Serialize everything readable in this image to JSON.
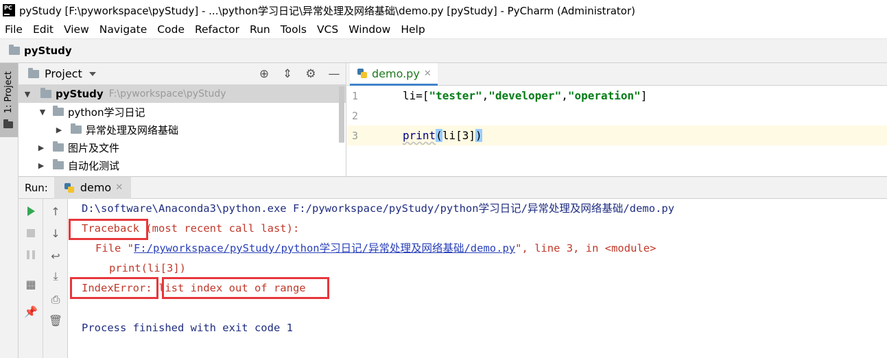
{
  "window": {
    "title": "pyStudy [F:\\pyworkspace\\pyStudy] - ...\\python学习日记\\异常处理及网络基础\\demo.py [pyStudy] - PyCharm (Administrator)"
  },
  "menu": [
    "File",
    "Edit",
    "View",
    "Navigate",
    "Code",
    "Refactor",
    "Run",
    "Tools",
    "VCS",
    "Window",
    "Help"
  ],
  "navbar": {
    "project": "pyStudy"
  },
  "left_strip": {
    "tab_label": "1: Project"
  },
  "project_panel": {
    "title": "Project",
    "tree": [
      {
        "label": "pyStudy",
        "path": "F:\\pyworkspace\\pyStudy",
        "expanded": true
      },
      {
        "label": "python学习日记",
        "expanded": true
      },
      {
        "label": "异常处理及网络基础",
        "expanded": false
      },
      {
        "label": "图片及文件",
        "expanded": false
      },
      {
        "label": "自动化测试",
        "expanded": false
      }
    ]
  },
  "editor": {
    "tab_label": "demo.py",
    "lines": [
      {
        "num": "1",
        "text": "li=[\"tester\",\"developer\",\"operation\"]"
      },
      {
        "num": "2",
        "text": ""
      },
      {
        "num": "3",
        "text": "print(li[3])"
      }
    ],
    "tokens": {
      "l1_a": "li=[",
      "l1_s1": "\"tester\"",
      "l1_c1": ",",
      "l1_s2": "\"developer\"",
      "l1_c2": ",",
      "l1_s3": "\"operation\"",
      "l1_b": "]",
      "l3_kw": "print",
      "l3_open": "(",
      "l3_mid": "li[3]",
      "l3_close": ")"
    }
  },
  "run": {
    "label": "Run:",
    "tab_label": "demo",
    "console": {
      "cmd": "D:\\software\\Anaconda3\\python.exe F:/pyworkspace/pyStudy/python学习日记/异常处理及网络基础/demo.py",
      "traceback_word": "Traceback",
      "traceback_rest": " (most recent call last):",
      "file_prefix": "File \"",
      "file_link": "F:/pyworkspace/pyStudy/python学习日记/异常处理及网络基础/demo.py",
      "file_suffix": "\", line 3, in <module>",
      "code_line": "print(li[3])",
      "error_type": "IndexError:",
      "error_msg": "list index out of range",
      "exit": "Process finished with exit code 1"
    }
  },
  "colors": {
    "highlight_box": "#e8363b",
    "string": "#067d17",
    "console_error": "#c0392b",
    "console_output": "#1f2d80"
  }
}
